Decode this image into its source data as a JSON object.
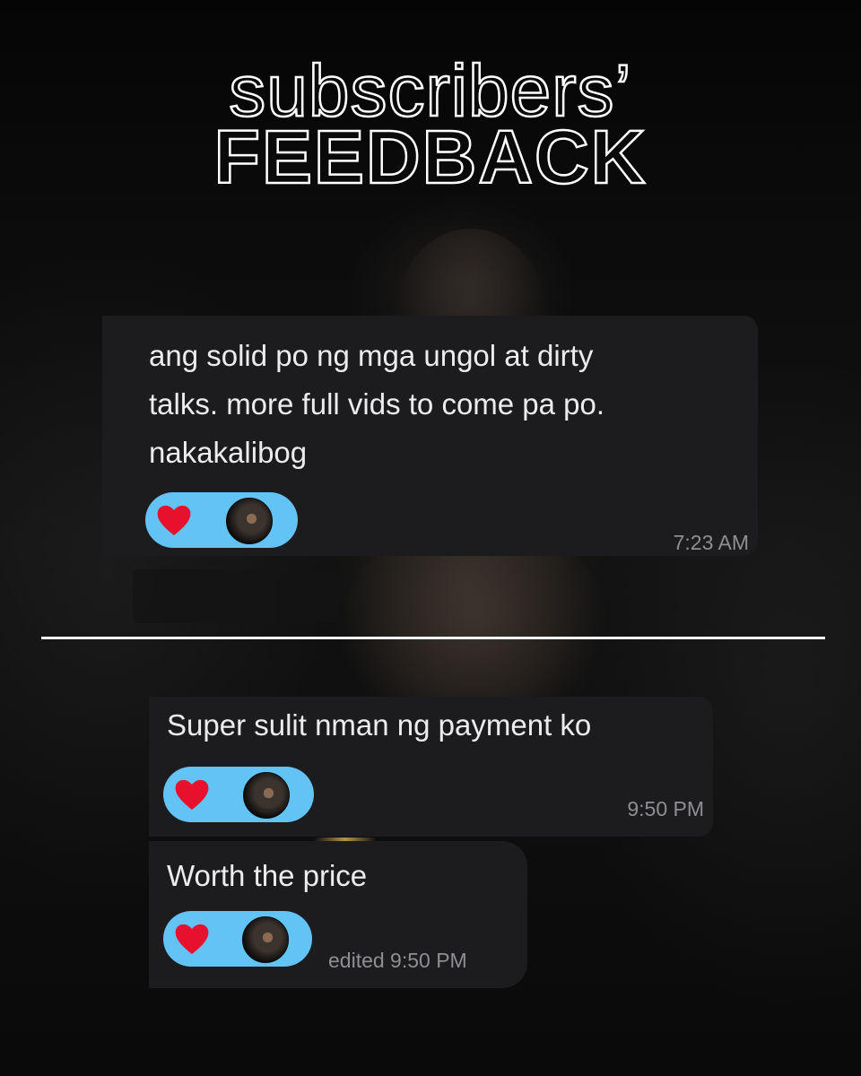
{
  "header": {
    "title_line1": "subscribers’",
    "title_line2": "FEEDBACK"
  },
  "messages": [
    {
      "lines": [
        "ang solid po ng mga ungol at dirty",
        "talks. more full vids to come pa po.",
        "nakakalibog"
      ],
      "reaction": "heart-icon",
      "time": "7:23 AM"
    },
    {
      "lines": [
        "Super sulit nman ng payment ko"
      ],
      "reaction": "heart-icon",
      "time": "9:50 PM"
    },
    {
      "lines": [
        "Worth the price"
      ],
      "reaction": "heart-icon",
      "time": "edited 9:50 PM"
    }
  ],
  "colors": {
    "background": "#060606",
    "bubble": "#1c1c1e",
    "reaction_pill": "#62c3f4",
    "heart": "#e8112d",
    "timestamp": "#8e8e93",
    "message_text": "#ececee"
  }
}
